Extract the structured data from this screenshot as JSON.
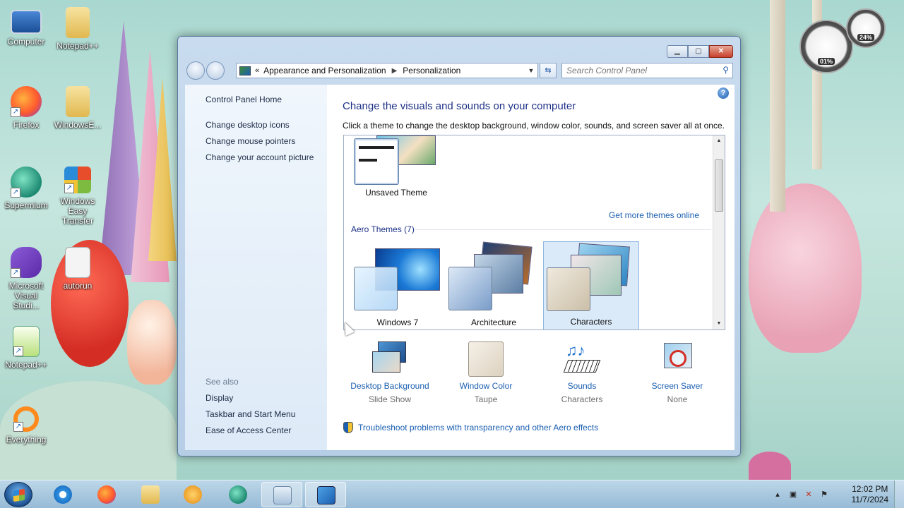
{
  "desktop": {
    "icons": [
      {
        "label": "Computer"
      },
      {
        "label": "Notepad++"
      },
      {
        "label": "Firefox"
      },
      {
        "label": "WindowsE..."
      },
      {
        "label": "Supermium"
      },
      {
        "label": "Windows Easy Transfer"
      },
      {
        "label": "Microsoft Visual Studi..."
      },
      {
        "label": "autorun"
      },
      {
        "label": "Notepad++"
      },
      {
        "label": "Everything"
      }
    ]
  },
  "gadget": {
    "cpu": "01%",
    "mem": "24%"
  },
  "window": {
    "breadcrumb": {
      "root": "Appearance and Personalization",
      "current": "Personalization"
    },
    "search_placeholder": "Search Control Panel",
    "left": {
      "home": "Control Panel Home",
      "links": [
        "Change desktop icons",
        "Change mouse pointers",
        "Change your account picture"
      ],
      "see_also": "See also",
      "see_also_links": [
        "Display",
        "Taskbar and Start Menu",
        "Ease of Access Center"
      ]
    },
    "heading": "Change the visuals and sounds on your computer",
    "subheading": "Click a theme to change the desktop background, window color, sounds, and screen saver all at once.",
    "themes": {
      "unsaved": "Unsaved Theme",
      "get_more": "Get more themes online",
      "aero_header": "Aero Themes (7)",
      "aero": [
        "Windows 7",
        "Architecture",
        "Characters"
      ],
      "selected": "Characters"
    },
    "bottom": [
      {
        "title": "Desktop Background",
        "value": "Slide Show",
        "icon": "desktop-background-icon"
      },
      {
        "title": "Window Color",
        "value": "Taupe",
        "icon": "window-color-icon"
      },
      {
        "title": "Sounds",
        "value": "Characters",
        "icon": "sounds-icon"
      },
      {
        "title": "Screen Saver",
        "value": "None",
        "icon": "screen-saver-icon"
      }
    ],
    "troubleshoot": "Troubleshoot problems with transparency and other Aero effects",
    "colors": {
      "link": "#1b5fb0",
      "heading": "#1e3287",
      "taupe": "#e6ddcf"
    }
  },
  "taskbar": {
    "time": "12:02 PM",
    "date": "11/7/2024",
    "apps": [
      "internet-explorer-icon",
      "firefox-icon",
      "file-explorer-icon",
      "media-player-icon",
      "supermium-icon",
      "notepad-icon",
      "control-panel-icon"
    ]
  }
}
